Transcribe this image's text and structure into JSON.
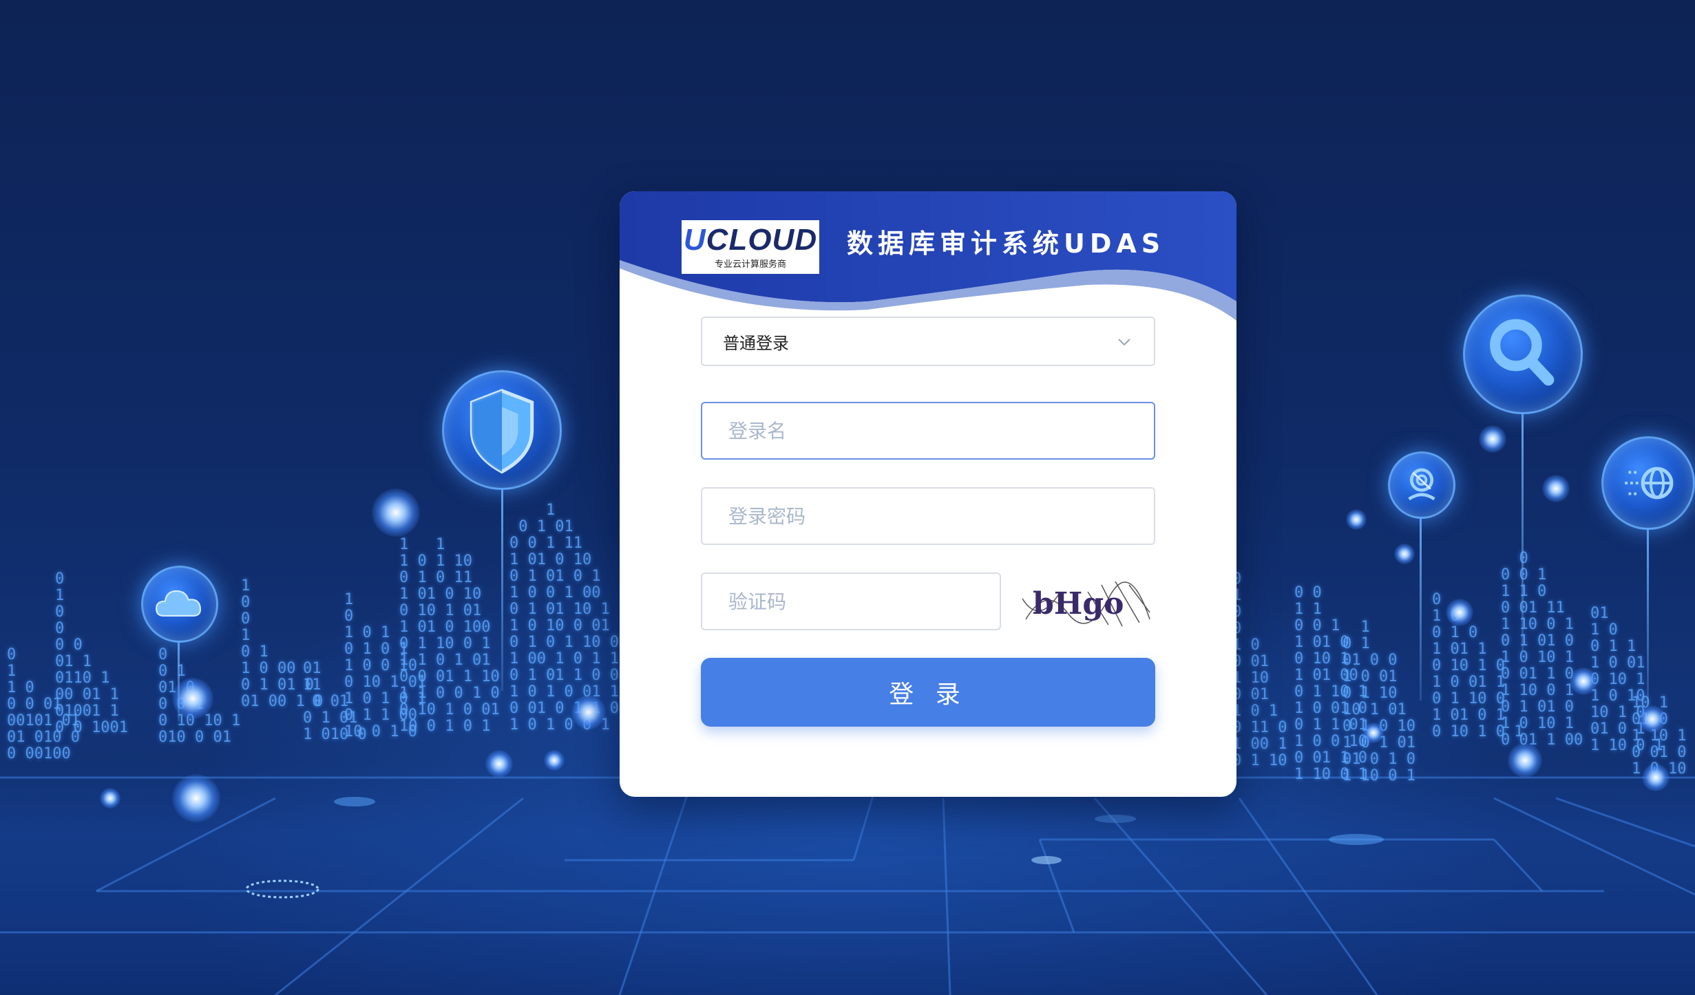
{
  "brand": {
    "logo_text_u": "U",
    "logo_text_rest": "CLOUD",
    "logo_tagline": "专业云计算服务商",
    "app_title": "数据库审计系统UDAS"
  },
  "login_form": {
    "login_type_selected": "普通登录",
    "username_placeholder": "登录名",
    "password_placeholder": "登录密码",
    "captcha_placeholder": "验证码",
    "captcha_text": "bHgo",
    "login_button_label": "登 录"
  },
  "colors": {
    "primary_button": "#467fe6",
    "header_gradient_start": "#1e3aa8",
    "header_gradient_end": "#2b4fc4",
    "background_dark": "#0d2356"
  },
  "background_icons": [
    "cloud-icon",
    "shield-icon",
    "magnifier-icon",
    "fingerprint-icon",
    "globe-icon"
  ]
}
